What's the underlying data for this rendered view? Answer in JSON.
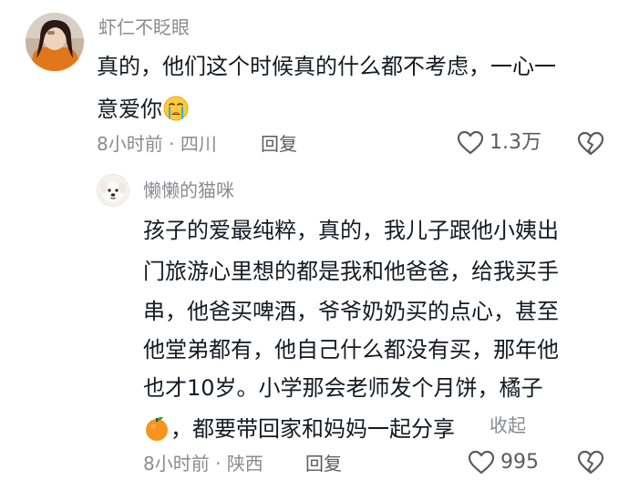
{
  "comments": [
    {
      "username": "虾仁不眨眼",
      "text_lines": [
        "真的，他们这个时候真的什么都不考虑，一心一",
        "意爱你"
      ],
      "trailing_emoji_icon": "crying-face-emoji-icon",
      "time": "8小时前",
      "separator": "·",
      "location": "四川",
      "reply_label": "回复",
      "like_count": "1.3万",
      "avatar_icon": "user-photo-avatar"
    },
    {
      "username": "懒懒的猫咪",
      "text_lines": [
        "孩子的爱最纯粹，真的，我儿子跟他小姨出",
        "门旅游心里想的都是我和他爸爸，给我买手",
        "串，他爸买啤酒，爷爷奶奶买的点心，甚至",
        "他堂弟都有，他自己什么都没有买，那年他",
        "也才10岁。小学那会老师发个月饼，橘子"
      ],
      "last_line_leading_emoji_icon": "tangerine-emoji-icon",
      "last_line": "，都要带回家和妈妈一起分享",
      "collapse_label": "收起",
      "time": "8小时前",
      "separator": "·",
      "location": "陕西",
      "reply_label": "回复",
      "like_count": "995",
      "avatar_icon": "white-dog-avatar"
    }
  ],
  "icons": {
    "like": "heart-outline-icon",
    "dislike": "broken-heart-outline-icon"
  },
  "colors": {
    "primary_text": "#161823",
    "secondary_text": "#8a8b91",
    "action_text": "#5a5b62"
  }
}
